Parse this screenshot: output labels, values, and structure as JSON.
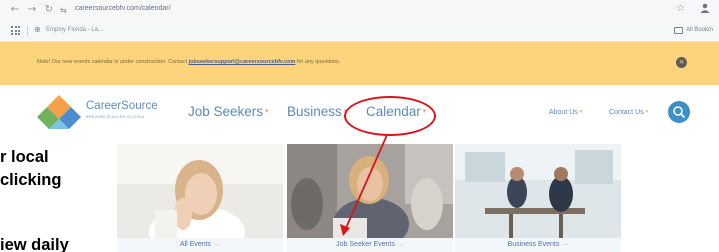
{
  "browser": {
    "url": "careersourcebfv.com/calendar/",
    "bookmark_label": "Employ Florida - La...",
    "all_bookmarks": "All Bookm"
  },
  "notice": {
    "text_before": "Note! Our new events calendar is under construction. Contact ",
    "link_text": "jobseekersupport@careersourcebfv.com",
    "text_after": " for any questions."
  },
  "logo": {
    "name": "CareerSource",
    "subtitle": "BREVARD FLAGLER VOLUSIA"
  },
  "nav": {
    "job_seekers": "Job Seekers",
    "business": "Business",
    "calendar": "Calendar",
    "about_us": "About Us",
    "contact_us": "Contact Us"
  },
  "cards": [
    {
      "label": "All Events",
      "arrow": "→"
    },
    {
      "label": "Job Seeker Events",
      "arrow": "→"
    },
    {
      "label": "Business Events",
      "arrow": "→"
    }
  ],
  "doc_text": {
    "line1": "r local",
    "line2": "clicking",
    "line3": "iew daily"
  },
  "colors": {
    "notice_bg": "#fcd47c",
    "nav_text": "#5f89b8",
    "caret": "#f0a35b",
    "annotation_red": "#d9151c",
    "search_blue": "#3d8fc8"
  },
  "icons": {
    "back": "arrow-left",
    "forward": "arrow-right",
    "reload": "reload",
    "site": "tune",
    "bookmark": "star",
    "profile": "person",
    "apps": "grid",
    "globe": "globe",
    "folder": "folder",
    "close": "x",
    "search": "magnifier"
  }
}
